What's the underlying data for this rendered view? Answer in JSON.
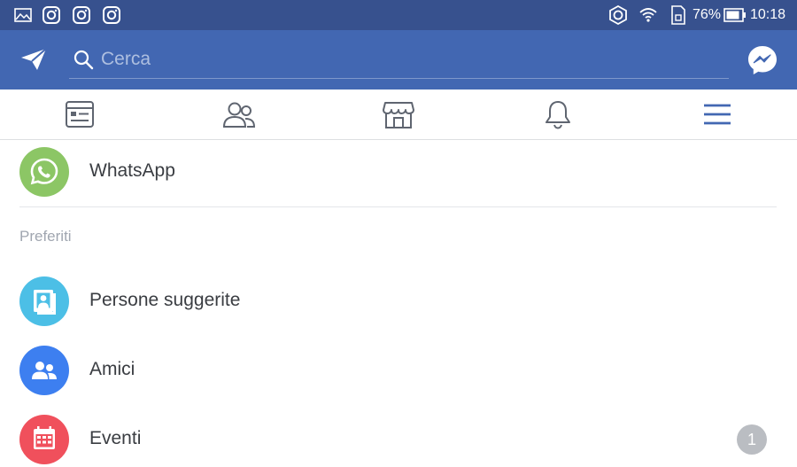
{
  "status_bar": {
    "battery_percent": "76%",
    "time": "10:18",
    "icons": [
      "gallery-icon",
      "instagram-icon",
      "instagram-icon",
      "instagram-icon",
      "sync-icon",
      "wifi-icon",
      "sim-icon",
      "battery-icon"
    ]
  },
  "header": {
    "search_placeholder": "Cerca",
    "icons": [
      "send-icon",
      "search-icon",
      "messenger-icon"
    ]
  },
  "tabs": [
    {
      "name": "news-feed",
      "icon": "news-feed-icon"
    },
    {
      "name": "friends",
      "icon": "friends-icon"
    },
    {
      "name": "marketplace",
      "icon": "marketplace-icon"
    },
    {
      "name": "notifications",
      "icon": "bell-icon"
    },
    {
      "name": "menu",
      "icon": "hamburger-menu-icon",
      "active": true
    }
  ],
  "menu": {
    "top_items": [
      {
        "label": "WhatsApp",
        "icon": "whatsapp-icon",
        "color": "#8cc665"
      }
    ],
    "section_title": "Preferiti",
    "favorites": [
      {
        "label": "Persone suggerite",
        "icon": "suggested-people-icon",
        "color": "#4cbfe6"
      },
      {
        "label": "Amici",
        "icon": "friends-icon",
        "color": "#3d7ff0"
      },
      {
        "label": "Eventi",
        "icon": "calendar-icon",
        "color": "#f0505c",
        "badge": "1"
      }
    ]
  },
  "colors": {
    "status_bar": "#37518e",
    "header": "#4267b2",
    "active_tab": "#4267b2",
    "inactive_tab": "#5f6570"
  }
}
